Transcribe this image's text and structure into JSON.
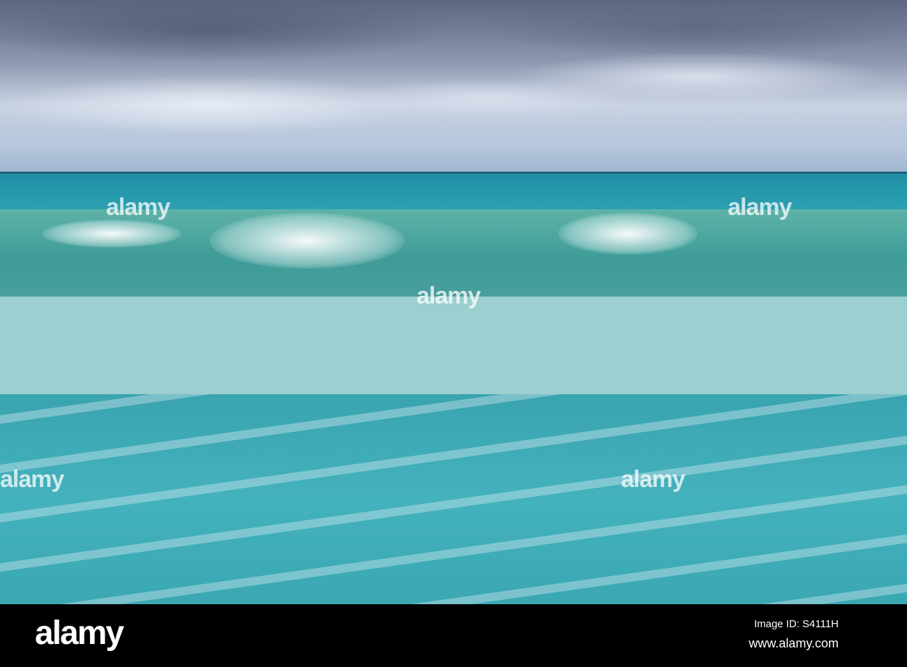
{
  "photo": {
    "subject": "ocean waves under cloudy sky"
  },
  "watermark": "alamy",
  "footer": {
    "logo": "alamy",
    "image_id": "Image ID: S4111H",
    "website": "www.alamy.com"
  }
}
